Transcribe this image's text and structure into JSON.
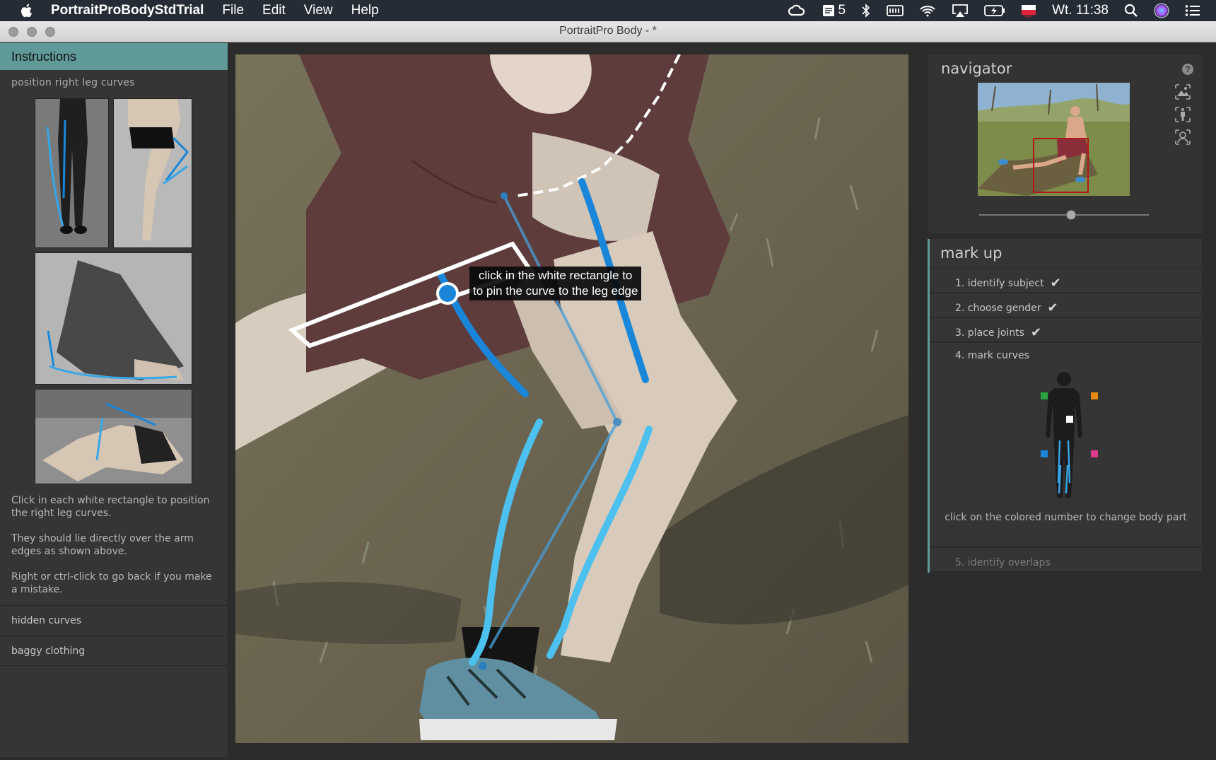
{
  "menubar": {
    "app_name": "PortraitProBodyStdTrial",
    "menus": [
      "File",
      "Edit",
      "View",
      "Help"
    ],
    "notification_count": "5",
    "clock": "Wt. 11:38"
  },
  "window": {
    "title": "PortraitPro Body -  *"
  },
  "instructions": {
    "header": "Instructions",
    "subtitle": "position right leg curves",
    "paragraphs": [
      "Click in each white rectangle to position the right leg curves.",
      "They should lie directly over the arm edges as shown above.",
      "Right or ctrl-click to go back if you make a mistake."
    ],
    "sections": [
      "hidden curves",
      "baggy clothing"
    ]
  },
  "canvas": {
    "tooltip_line1": "click in the white rectangle to",
    "tooltip_line2": "to pin the curve to the leg edge"
  },
  "navigator": {
    "label": "navigator",
    "help": "?",
    "zoom_fraction": 0.54
  },
  "markup": {
    "label": "mark up",
    "steps": [
      {
        "label": "1. identify subject",
        "done": true
      },
      {
        "label": "2. choose gender",
        "done": true
      },
      {
        "label": "3. place joints",
        "done": true
      },
      {
        "label": "4. mark curves",
        "done": false
      },
      {
        "label": "5. identify overlaps",
        "done": false
      }
    ],
    "check_glyph": "✔",
    "hint": "click on the colored number to change body part"
  },
  "colors": {
    "accent_teal": "#5f9a98",
    "curve_blue": "#1a86d9",
    "curve_light_blue": "#4cc0ef",
    "bodypart_green": "#2aa43c",
    "bodypart_orange": "#e88a12",
    "bodypart_blue": "#1a86d9",
    "bodypart_pink": "#e0398a"
  }
}
